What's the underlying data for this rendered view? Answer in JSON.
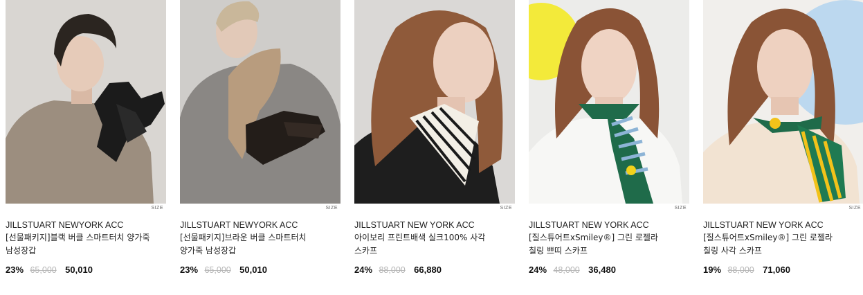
{
  "products": [
    {
      "image": "man-black-leather-gloves-photo",
      "size_tag": "SIZE",
      "brand": "JILLSTUART NEWYORK ACC",
      "name": "[선물패키지]블랙 버클 스마트터치 양가죽 남성장갑",
      "discount": "23%",
      "original_price": "65,000",
      "sale_price": "50,010"
    },
    {
      "image": "man-brown-leather-gloves-photo",
      "size_tag": "SIZE",
      "brand": "JILLSTUART NEWYORK ACC",
      "name": "[선물패키지]브라운 버클 스마트터치 양가죽 남성장갑",
      "discount": "23%",
      "original_price": "65,000",
      "sale_price": "50,010"
    },
    {
      "image": "woman-ivory-silk-scarf-photo",
      "size_tag": "SIZE",
      "brand": "JILLSTUART NEW YORK ACC",
      "name": "아이보리 프린트배색 실크100% 사각 스카프",
      "discount": "24%",
      "original_price": "88,000",
      "sale_price": "66,880"
    },
    {
      "image": "woman-green-smiley-band-scarf-photo",
      "size_tag": "SIZE",
      "brand": "JILLSTUART NEW YORK ACC",
      "name": "[질스튜어트xSmiley®] 그린 로젤라 칠링 쁘띠 스카프",
      "discount": "24%",
      "original_price": "48,000",
      "sale_price": "36,480"
    },
    {
      "image": "woman-green-smiley-square-scarf-photo",
      "size_tag": "SIZE",
      "brand": "JILLSTUART NEW YORK ACC",
      "name": "[질스튜어트xSmiley®] 그린 로젤라 칠링 사각 스카프",
      "discount": "19%",
      "original_price": "88,000",
      "sale_price": "71,060"
    }
  ]
}
